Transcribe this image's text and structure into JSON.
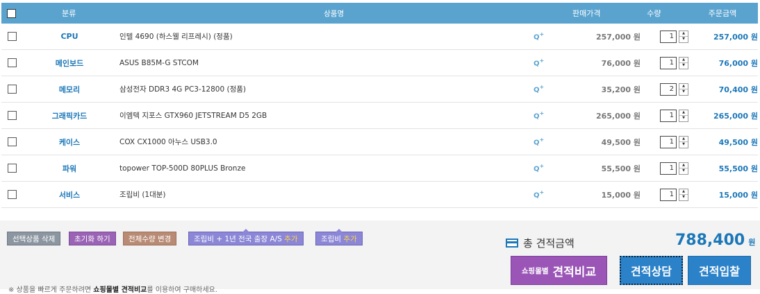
{
  "header": {
    "category": "분류",
    "name": "상품명",
    "price": "판매가격",
    "qty": "수량",
    "total": "주문금액"
  },
  "rows": [
    {
      "category": "CPU",
      "name": "인텔 4690 (하스웰 리프레시) (정품)",
      "price": "257,000 원",
      "qty": "1",
      "total": "257,000 원"
    },
    {
      "category": "메인보드",
      "name": "ASUS B85M-G STCOM",
      "price": "76,000 원",
      "qty": "1",
      "total": "76,000 원"
    },
    {
      "category": "메모리",
      "name": "삼성전자 DDR3 4G PC3-12800 (정품)",
      "price": "35,200 원",
      "qty": "2",
      "total": "70,400 원"
    },
    {
      "category": "그래픽카드",
      "name": "이엠텍 지포스 GTX960 JETSTREAM D5 2GB",
      "price": "265,000 원",
      "qty": "1",
      "total": "265,000 원"
    },
    {
      "category": "케이스",
      "name": "COX CX1000 아누스 USB3.0",
      "price": "49,500 원",
      "qty": "1",
      "total": "49,500 원"
    },
    {
      "category": "파워",
      "name": "topower TOP-500D 80PLUS Bronze",
      "price": "55,500 원",
      "qty": "1",
      "total": "55,500 원"
    },
    {
      "category": "서비스",
      "name": "조립비 (1대분)",
      "price": "15,000 원",
      "qty": "1",
      "total": "15,000 원"
    }
  ],
  "zoom_label": "Q+",
  "buttons": {
    "delete_selected": "선택상품 삭제",
    "reset": "초기화 하기",
    "change_qty": "전체수량 변경",
    "assembly_as_prefix": "조립비 + 1년 전국 출장 A/S ",
    "assembly_as_add": "추가",
    "assembly_prefix": "조립비 ",
    "assembly_add": "추가"
  },
  "total": {
    "label": "총 견적금액",
    "value": "788,400",
    "unit": "원"
  },
  "actions": {
    "compare_small": "쇼핑몰별",
    "compare": "견적비교",
    "consult": "견적상담",
    "bid": "견적입찰"
  },
  "note": {
    "prefix": "※ 상품을 빠르게 주문하려면 ",
    "bold": "쇼핑몰별 견적비교",
    "suffix": "를 이용하여 구매하세요."
  },
  "colors": {
    "header_bg": "#5aa3cf",
    "accent_blue": "#1b77b8",
    "purple": "#9a55b6"
  }
}
